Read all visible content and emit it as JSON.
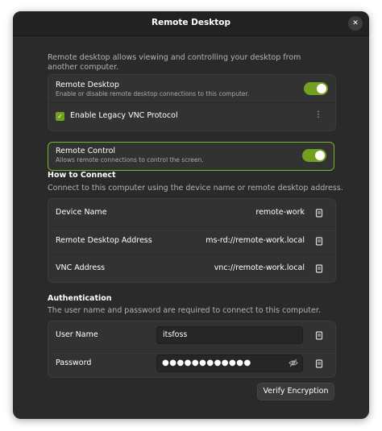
{
  "window": {
    "title": "Remote Desktop",
    "close_icon": "close-icon"
  },
  "intro": "Remote desktop allows viewing and controlling your desktop from another computer.",
  "sharing": {
    "remote_desktop": {
      "label": "Remote Desktop",
      "description": "Enable or disable remote desktop connections to this computer.",
      "enabled": true
    },
    "legacy_vnc": {
      "label": "Enable Legacy VNC Protocol",
      "checked": true
    },
    "remote_control": {
      "label": "Remote Control",
      "description": "Allows remote connections to control the screen.",
      "enabled": true
    }
  },
  "how_to_connect": {
    "title": "How to Connect",
    "description": "Connect to this computer using the device name or remote desktop address.",
    "rows": [
      {
        "label": "Device Name",
        "value": "remote-work"
      },
      {
        "label": "Remote Desktop Address",
        "value": "ms-rd://remote-work.local"
      },
      {
        "label": "VNC Address",
        "value": "vnc://remote-work.local"
      }
    ]
  },
  "authentication": {
    "title": "Authentication",
    "description": "The user name and password are required to connect to this computer.",
    "username_label": "User Name",
    "username_value": "itsfoss",
    "password_label": "Password",
    "password_value": "●●●●●●●●●●●●",
    "verify_button": "Verify Encryption"
  },
  "colors": {
    "accent": "#71a11f",
    "window_bg": "#2a2a2a",
    "row_bg": "#323232"
  }
}
